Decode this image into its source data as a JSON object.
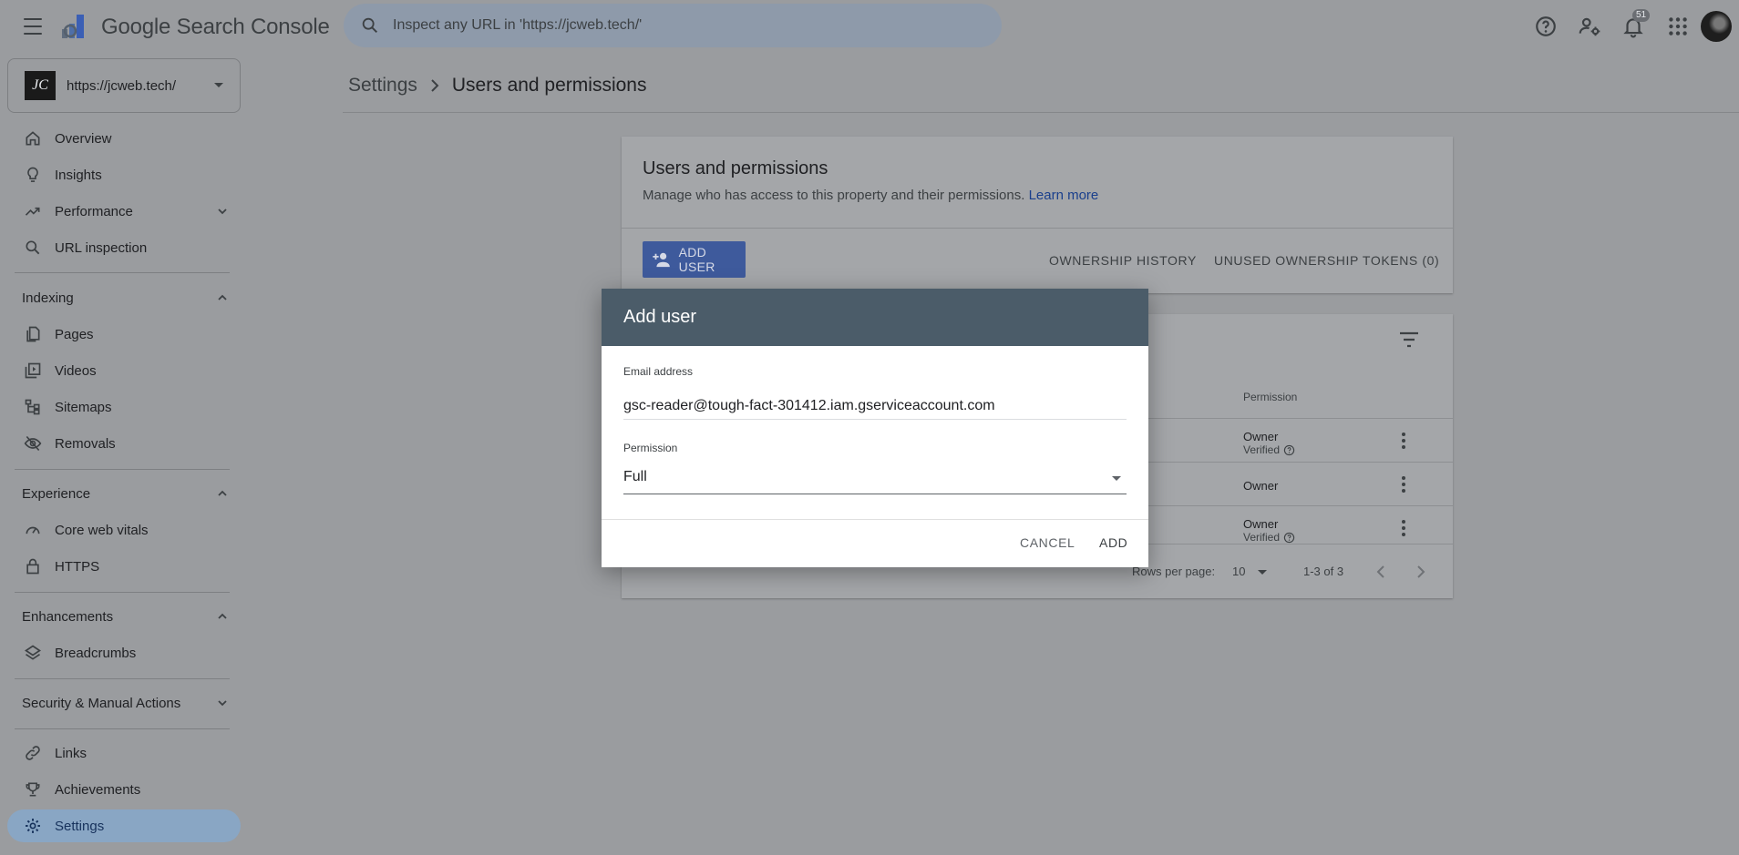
{
  "header": {
    "product_name": "Google Search Console",
    "search_placeholder": "Inspect any URL in 'https://jcweb.tech/'",
    "notification_count": "51"
  },
  "property": {
    "logo_text": "JC",
    "url": "https://jcweb.tech/"
  },
  "sidebar": {
    "overview": "Overview",
    "insights": "Insights",
    "performance": "Performance",
    "url_inspection": "URL inspection",
    "indexing": {
      "title": "Indexing",
      "pages": "Pages",
      "videos": "Videos",
      "sitemaps": "Sitemaps",
      "removals": "Removals"
    },
    "experience": {
      "title": "Experience",
      "core_web_vitals": "Core web vitals",
      "https": "HTTPS"
    },
    "enhancements": {
      "title": "Enhancements",
      "breadcrumbs": "Breadcrumbs"
    },
    "security": {
      "title": "Security & Manual Actions"
    },
    "links": "Links",
    "achievements": "Achievements",
    "settings": "Settings"
  },
  "breadcrumb": {
    "parent": "Settings",
    "current": "Users and permissions"
  },
  "users_card": {
    "title": "Users and permissions",
    "subtitle": "Manage who has access to this property and their permissions.",
    "learn_more": "Learn more",
    "add_user": "ADD USER",
    "ownership_history": "OWNERSHIP HISTORY",
    "unused_tokens": "UNUSED OWNERSHIP TOKENS (0)"
  },
  "users_table": {
    "permission_header": "Permission",
    "rows": [
      {
        "permission": "Owner",
        "status": "Verified"
      },
      {
        "permission": "Owner",
        "status": ""
      },
      {
        "permission": "Owner",
        "status": "Verified"
      }
    ],
    "rows_per_page_label": "Rows per page:",
    "rows_per_page": "10",
    "range": "1-3 of 3"
  },
  "dialog": {
    "title": "Add user",
    "email_label": "Email address",
    "email_value": "gsc-reader@tough-fact-301412.iam.gserviceaccount.com",
    "permission_label": "Permission",
    "permission_value": "Full",
    "cancel": "CANCEL",
    "add": "ADD"
  }
}
